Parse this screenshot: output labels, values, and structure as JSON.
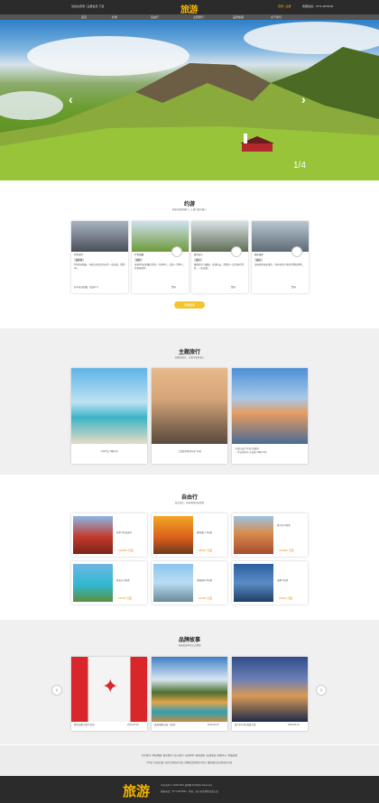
{
  "topbar": {
    "left": "请您先登录 | 注册会员 下载",
    "logo": "旅游",
    "right": "登录 | 注册",
    "phone": "客服热线：0771-9876543"
  },
  "nav": [
    "首页",
    "约游",
    "自由行",
    "主题旅行",
    "品牌故事",
    "关于我们"
  ],
  "hero": {
    "counter": "1/4"
  },
  "yueyou": {
    "title": "约游",
    "subtitle": "精彩目的地旅行，让旅行更有意义",
    "button": "查看更多",
    "cards": [
      {
        "name": "约伴出行",
        "tag": "结伴游",
        "text": "6月初去西藏，寻找志同道合的伙伴一起出发，费用AA。",
        "foot": "分享来自西藏 · 阅读(17)"
      },
      {
        "name": "行者无疆",
        "tag": "结伴",
        "text": "准备8月去新疆自驾游，已有两人，还差一至两人，有意者联系。",
        "foot": "赞同"
      },
      {
        "name": "旅行达人",
        "tag": "骑行",
        "text": "暑假骑行川藏线，寻找队友，需要有一定的骑行经验，一起出发。",
        "foot": "赞同"
      },
      {
        "name": "城市漫步",
        "tag": "城市",
        "text": "周末相约城市漫步，探寻老街小巷的美食和风景。",
        "foot": "赞同"
      }
    ]
  },
  "theme": {
    "title": "主题旅行",
    "subtitle": "有趣的旅行，让旅行更有意义",
    "items": [
      {
        "caption": "马尔代夫 5晚 6日"
      },
      {
        "caption": "土耳其伊斯坦布尔 10日"
      },
      {
        "caption": "旧金山金门大桥 深度游\n一生必游的十大名城 12晚 14日"
      }
    ]
  },
  "free": {
    "title": "自由行",
    "subtitle": "说走就走，想去哪里就去哪里",
    "items": [
      {
        "text": "日本 5日自由行",
        "price": "¥11800 元起"
      },
      {
        "text": "香港澳门 4日游",
        "price": "¥8900 元起"
      },
      {
        "text": "意大利 8日游",
        "price": "¥11800 元起"
      },
      {
        "text": "普吉岛 6日游",
        "price": "¥3700 元起"
      },
      {
        "text": "美国纽约 9日游",
        "price": "¥2700 元起"
      },
      {
        "text": "迪拜 7日游",
        "price": "¥3200 元起"
      }
    ]
  },
  "brand": {
    "title": "品牌故事",
    "subtitle": "记录旅途中的点点滴滴",
    "items": [
      {
        "caption": "我的加拿大旅行日记",
        "date": "2016.06.28"
      },
      {
        "caption": "黄石国家公园（美国）",
        "date": "2016.06.20"
      },
      {
        "caption": "意大利小镇 漫游之旅",
        "date": "2016.06.10"
      }
    ]
  },
  "footer": {
    "links1": "关于我们 | 网站地图 | 联系我们 | 加入我们 | 法律声明 | 旅游度假 | 友情链接 | 帮助中心 | 隐私政策",
    "links2": "ICP证 | 营业执照 | 旅行社经营许可证 | 网络文化经营许可证 | 增值电信业务经营许可证",
    "logo": "旅游",
    "copy": "Copyright © 2008-2016 旅游网 All Rights Reserved",
    "addr": "客服电话：0771-9876543　地址：南宁市青秀区民族大道"
  },
  "colors": {
    "accent": "#f4b400",
    "dark": "#2b2b2b"
  }
}
